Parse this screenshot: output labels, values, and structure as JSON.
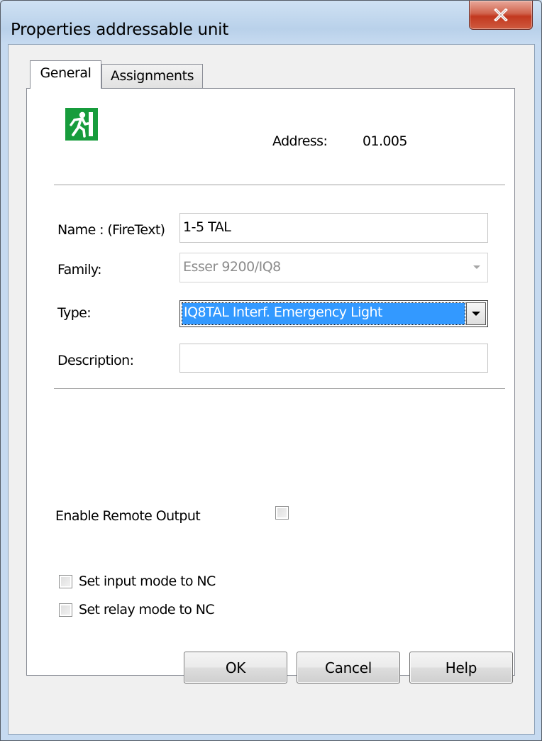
{
  "window": {
    "title": "Properties addressable unit",
    "close_label": "X"
  },
  "tabs": [
    {
      "label": "General",
      "active": true
    },
    {
      "label": "Assignments",
      "active": false
    }
  ],
  "general": {
    "icon": "emergency-exit-icon",
    "address_label": "Address:",
    "address_value": "01.005",
    "name_label": "Name : (FireText)",
    "name_value": "1-5 TAL",
    "family_label": "Family:",
    "family_value": "Esser 9200/IQ8",
    "type_label": "Type:",
    "type_value": "IQ8TAL Interf. Emergency Light",
    "description_label": "Description:",
    "description_value": "",
    "enable_remote_output_label": "Enable Remote Output",
    "enable_remote_output_checked": false,
    "input_mode_label": "Set input mode to NC",
    "input_mode_checked": false,
    "relay_mode_label": "Set relay mode to NC",
    "relay_mode_checked": false
  },
  "buttons": {
    "ok": "OK",
    "cancel": "Cancel",
    "help": "Help"
  },
  "colors": {
    "selection": "#3399ff",
    "exit_sign_green": "#179c3c",
    "close_red": "#c2381f"
  }
}
